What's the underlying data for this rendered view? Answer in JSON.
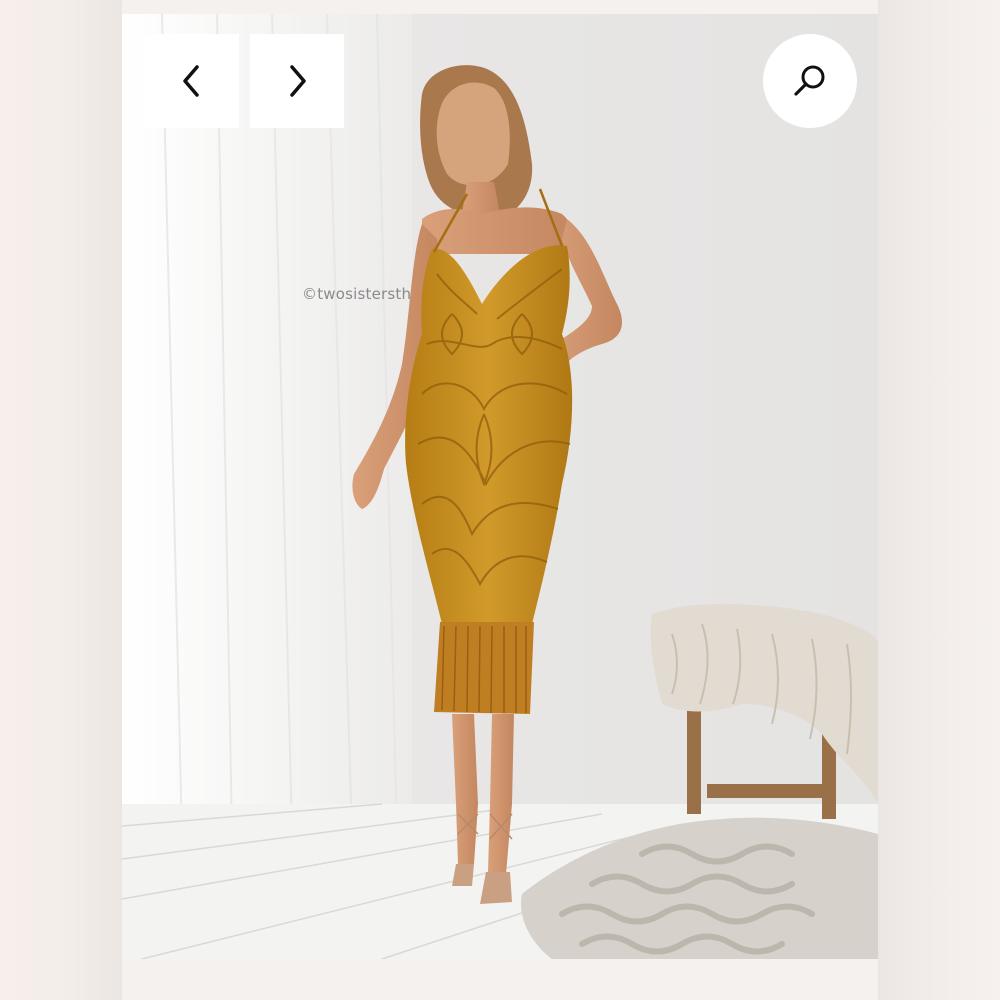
{
  "gallery": {
    "prev_icon": "chevron-left-icon",
    "next_icon": "chevron-right-icon",
    "search_icon": "search-icon",
    "watermark_text": "©twosistersth"
  },
  "colors": {
    "dress": "#c98f1f",
    "background": "#e9e7e5",
    "floor": "#f3f3f2",
    "throw": "#d9d2c8"
  }
}
